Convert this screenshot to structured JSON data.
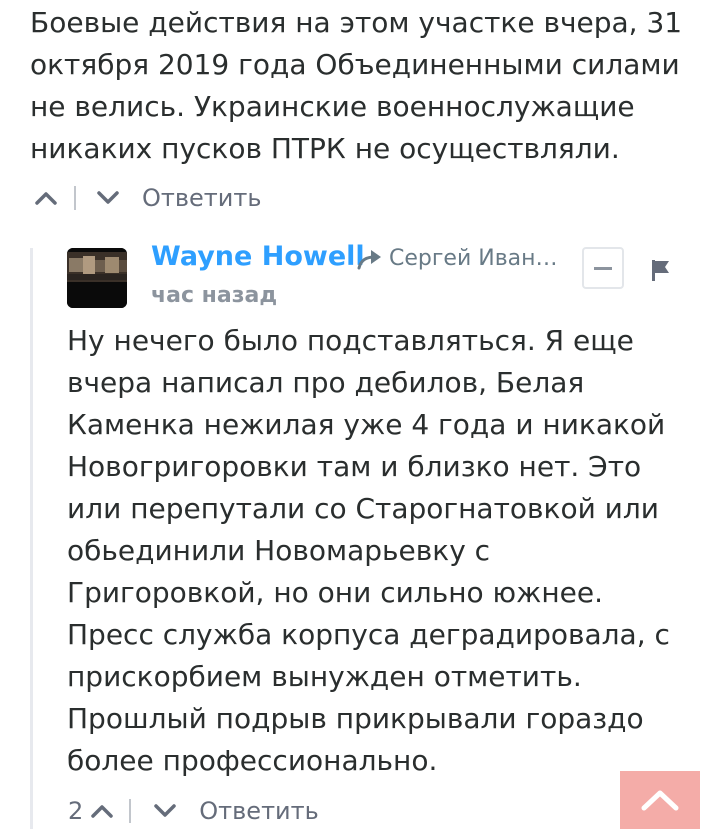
{
  "parent_comment": {
    "text": "Боевые действия на этом участке вчера, 31\nоктября 2019 года Объединенными силами\nне велись. Украинские военнослужащие\nникаких пусков ПТРК не осуществляли.",
    "reply_label": "Ответить"
  },
  "reply_comment": {
    "author": "Wayne Howell",
    "reply_to": "Сергей Иван…",
    "timestamp": "час назад",
    "text": "Ну нечего было подставляться. Я еще\nвчера написал про дебилов, Белая\nКаменка нежилая уже 4 года и никакой\nНовогригоровки там и близко нет. Это\nили перепутали со Старогнатовкой или\nобьединили Новомарьевку с\nГригоровкой, но они сильно южнее.\nПресс служба корпуса деградировала, с\nприскорбием вынужден отметить.\nПрошлый подрыв прикрывали гораздо\nболее профессионально.",
    "upvotes": "2",
    "reply_label": "Ответить"
  },
  "colors": {
    "author": "#2e9fff",
    "text": "#2a2e2e",
    "muted": "#656c7a",
    "scroll_top_bg": "#f4aca8"
  },
  "icons": {
    "upvote": "chevron-up-icon",
    "downvote": "chevron-down-icon",
    "reply_arrow": "reply-arrow-icon",
    "collapse": "minus-icon",
    "flag": "flag-icon",
    "scroll_top": "arrow-up-icon"
  }
}
